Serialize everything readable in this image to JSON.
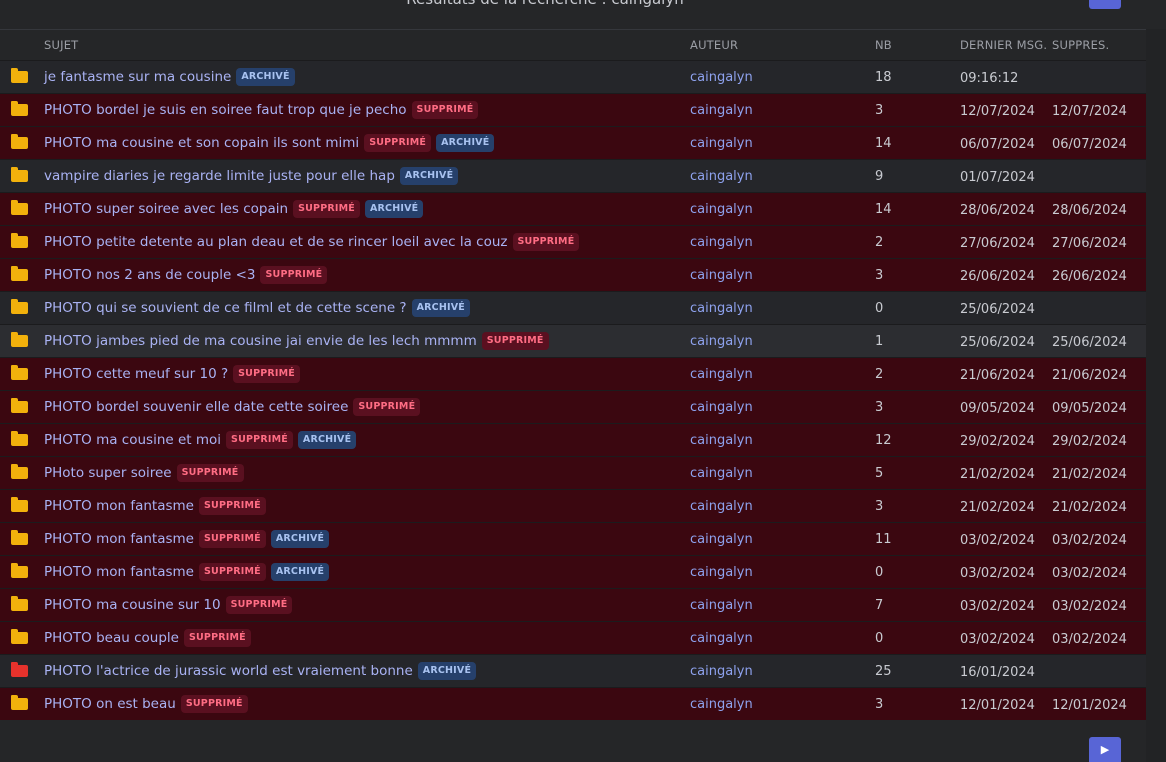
{
  "title": "Résultats de la recherche : caingalyn",
  "columns": {
    "subject": "SUJET",
    "author": "AUTEUR",
    "nb": "NB",
    "last_msg": "DERNIER MSG.",
    "deleted": "SUPPRES."
  },
  "labels": {
    "deleted": "SUPPRIMÉ",
    "archived": "ARCHIVÉ"
  },
  "icons": {
    "folder": "folder-icon",
    "next": "chevron-right-icon"
  },
  "colors": {
    "folder": "#f2b10c",
    "folder_hot": "#e6322c",
    "deleted_row": "#3b0710",
    "accent": "#5865d6"
  },
  "rows": [
    {
      "subject": "je fantasme sur ma cousine",
      "deleted": false,
      "archived": true,
      "author": "caingalyn",
      "nb": "18",
      "last": "09:16:12",
      "supp": "",
      "hot": false
    },
    {
      "subject": "PHOTO bordel je suis en soiree faut trop que je pecho",
      "deleted": true,
      "archived": false,
      "author": "caingalyn",
      "nb": "3",
      "last": "12/07/2024",
      "supp": "12/07/2024",
      "hot": false
    },
    {
      "subject": "PHOTO ma cousine et son copain ils sont mimi",
      "deleted": true,
      "archived": true,
      "author": "caingalyn",
      "nb": "14",
      "last": "06/07/2024",
      "supp": "06/07/2024",
      "hot": false
    },
    {
      "subject": "vampire diaries je regarde limite juste pour elle hap",
      "deleted": false,
      "archived": true,
      "author": "caingalyn",
      "nb": "9",
      "last": "01/07/2024",
      "supp": "",
      "hot": false
    },
    {
      "subject": "PHOTO super soiree avec les copain",
      "deleted": true,
      "archived": true,
      "author": "caingalyn",
      "nb": "14",
      "last": "28/06/2024",
      "supp": "28/06/2024",
      "hot": false
    },
    {
      "subject": "PHOTO petite detente au plan deau et de se rincer loeil avec la couz",
      "deleted": true,
      "archived": false,
      "author": "caingalyn",
      "nb": "2",
      "last": "27/06/2024",
      "supp": "27/06/2024",
      "hot": false
    },
    {
      "subject": "PHOTO nos 2 ans de couple <3",
      "deleted": true,
      "archived": false,
      "author": "caingalyn",
      "nb": "3",
      "last": "26/06/2024",
      "supp": "26/06/2024",
      "hot": false
    },
    {
      "subject": "PHOTO qui se souvient de ce filml et de cette scene ?",
      "deleted": false,
      "archived": true,
      "author": "caingalyn",
      "nb": "0",
      "last": "25/06/2024",
      "supp": "",
      "hot": false
    },
    {
      "subject": "PHOTO jambes pied de ma cousine jai envie de les lech mmmm",
      "deleted": true,
      "archived": false,
      "author": "caingalyn",
      "nb": "1",
      "last": "25/06/2024",
      "supp": "25/06/2024",
      "hot": false,
      "highlight": true
    },
    {
      "subject": "PHOTO cette meuf sur 10 ?",
      "deleted": true,
      "archived": false,
      "author": "caingalyn",
      "nb": "2",
      "last": "21/06/2024",
      "supp": "21/06/2024",
      "hot": false
    },
    {
      "subject": "PHOTO bordel souvenir elle date cette soiree",
      "deleted": true,
      "archived": false,
      "author": "caingalyn",
      "nb": "3",
      "last": "09/05/2024",
      "supp": "09/05/2024",
      "hot": false
    },
    {
      "subject": "PHOTO ma cousine et moi",
      "deleted": true,
      "archived": true,
      "author": "caingalyn",
      "nb": "12",
      "last": "29/02/2024",
      "supp": "29/02/2024",
      "hot": false
    },
    {
      "subject": "PHoto super soiree",
      "deleted": true,
      "archived": false,
      "author": "caingalyn",
      "nb": "5",
      "last": "21/02/2024",
      "supp": "21/02/2024",
      "hot": false
    },
    {
      "subject": "PHOTO mon fantasme",
      "deleted": true,
      "archived": false,
      "author": "caingalyn",
      "nb": "3",
      "last": "21/02/2024",
      "supp": "21/02/2024",
      "hot": false
    },
    {
      "subject": "PHOTO mon fantasme",
      "deleted": true,
      "archived": true,
      "author": "caingalyn",
      "nb": "11",
      "last": "03/02/2024",
      "supp": "03/02/2024",
      "hot": false
    },
    {
      "subject": "PHOTO mon fantasme",
      "deleted": true,
      "archived": true,
      "author": "caingalyn",
      "nb": "0",
      "last": "03/02/2024",
      "supp": "03/02/2024",
      "hot": false
    },
    {
      "subject": "PHOTO ma cousine sur 10",
      "deleted": true,
      "archived": false,
      "author": "caingalyn",
      "nb": "7",
      "last": "03/02/2024",
      "supp": "03/02/2024",
      "hot": false
    },
    {
      "subject": "PHOTO beau couple",
      "deleted": true,
      "archived": false,
      "author": "caingalyn",
      "nb": "0",
      "last": "03/02/2024",
      "supp": "03/02/2024",
      "hot": false
    },
    {
      "subject": "PHOTO l'actrice de jurassic world est vraiement bonne",
      "deleted": false,
      "archived": true,
      "author": "caingalyn",
      "nb": "25",
      "last": "16/01/2024",
      "supp": "",
      "hot": true
    },
    {
      "subject": "PHOTO on est beau",
      "deleted": true,
      "archived": false,
      "author": "caingalyn",
      "nb": "3",
      "last": "12/01/2024",
      "supp": "12/01/2024",
      "hot": false
    }
  ]
}
